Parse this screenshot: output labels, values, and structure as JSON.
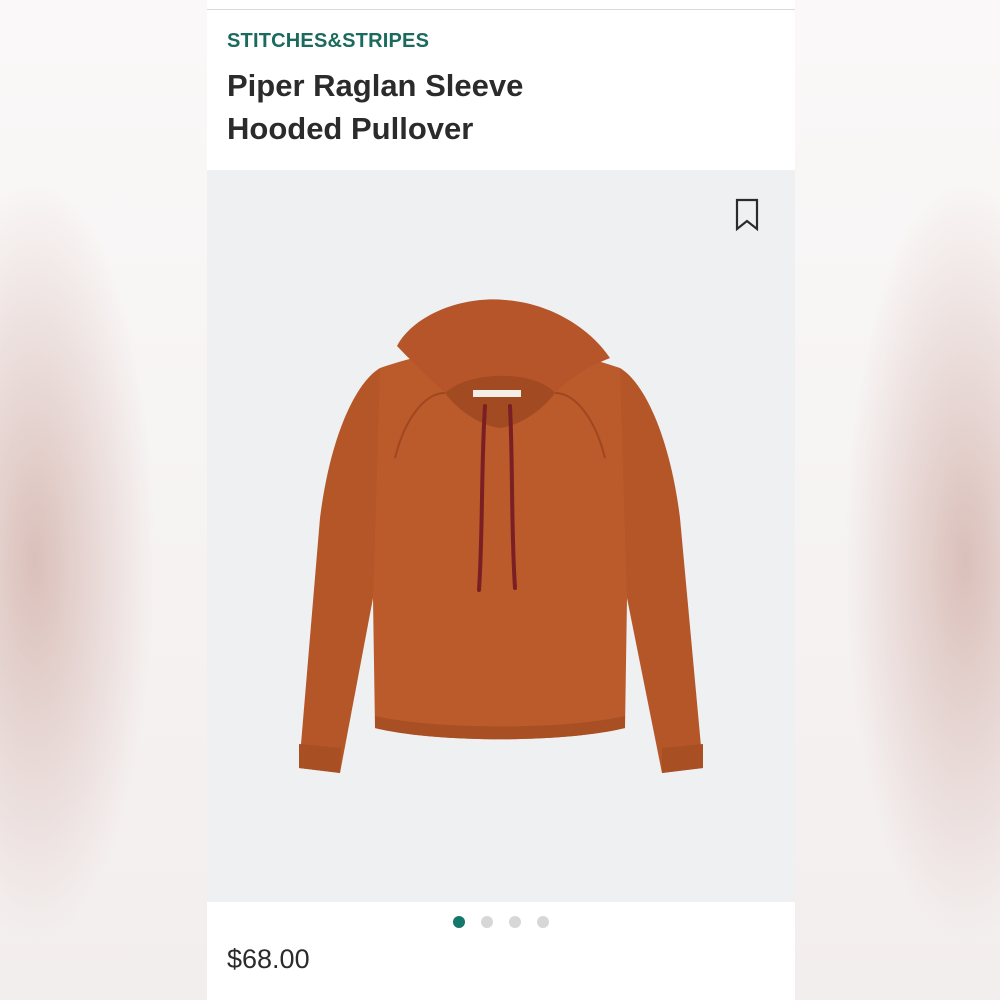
{
  "product": {
    "brand": "STITCHES&STRIPES",
    "title_line1": "Piper Raglan Sleeve",
    "title_line2": "Hooded Pullover",
    "price": "$68.00",
    "image_name": "hooded-pullover-image"
  },
  "carousel": {
    "count": 4,
    "active_index": 0
  },
  "icons": {
    "bookmark": "bookmark-icon"
  },
  "colors": {
    "brand": "#1a6b5e",
    "sweater": "#b95a2a",
    "drawstring": "#7a1f24",
    "active_dot": "#15766a",
    "inactive_dot": "#d7d7d7"
  }
}
